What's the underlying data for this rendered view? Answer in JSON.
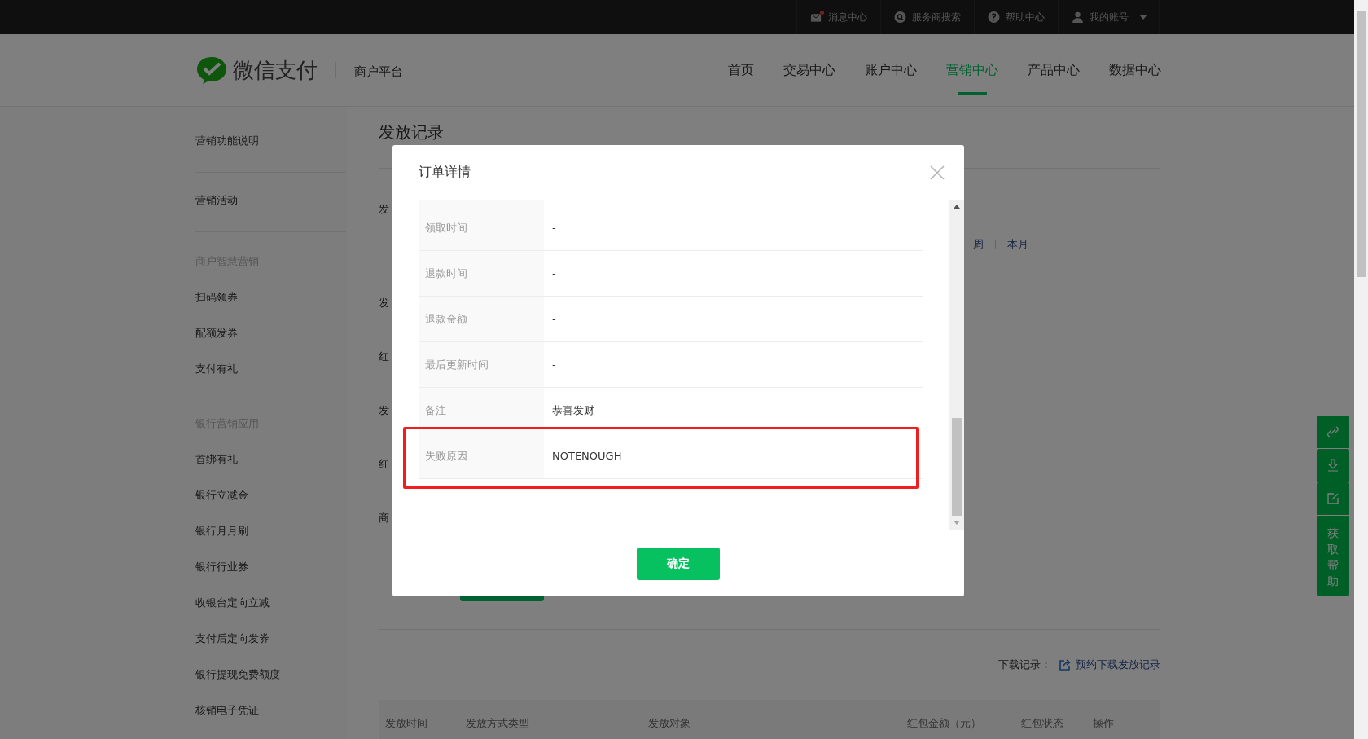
{
  "top_bar": {
    "items": [
      {
        "kind": "mail",
        "label": "消息中心",
        "unread": true
      },
      {
        "kind": "search",
        "label": "服务商搜索",
        "unread": false
      },
      {
        "kind": "help",
        "label": "帮助中心",
        "unread": false
      },
      {
        "kind": "account",
        "label": "我的账号",
        "unread": false
      }
    ]
  },
  "header": {
    "logo_text": "微信支付",
    "platform": "商户平台",
    "nav": [
      {
        "label": "首页",
        "selected": false
      },
      {
        "label": "交易中心",
        "selected": false
      },
      {
        "label": "账户中心",
        "selected": false
      },
      {
        "label": "营销中心",
        "selected": true
      },
      {
        "label": "产品中心",
        "selected": false
      },
      {
        "label": "数据中心",
        "selected": false
      }
    ]
  },
  "sidebar": {
    "sections": [
      {
        "items": [
          "营销功能说明"
        ]
      },
      {
        "items": [
          "营销活动"
        ]
      },
      {
        "heading": "商户智慧营销",
        "items": [
          "扫码领券",
          "配额发券",
          "支付有礼"
        ]
      },
      {
        "heading": "银行营销应用",
        "items": [
          "首绑有礼",
          "银行立减金",
          "银行月月刷",
          "银行行业券",
          "收银台定向立减",
          "支付后定向发券",
          "银行提现免费额度",
          "核销电子凭证"
        ]
      }
    ]
  },
  "main": {
    "title": "发放记录",
    "form_labels": [
      "发",
      "发",
      "红",
      "发",
      "红",
      "商"
    ],
    "date_links": [
      "周",
      "本月"
    ],
    "download_label": "下载记录：",
    "download_link": "预约下载发放记录",
    "table": {
      "columns": [
        "发放时间",
        "发放方式类型",
        "发放对象",
        "红包金额（元）",
        "红包状态",
        "操作"
      ]
    }
  },
  "modal": {
    "title": "订单详情",
    "rows": [
      {
        "label": "领取时间",
        "value": "-",
        "highlighted": false
      },
      {
        "label": "退款时间",
        "value": "-",
        "highlighted": false
      },
      {
        "label": "退款金额",
        "value": "-",
        "highlighted": false
      },
      {
        "label": "最后更新时间",
        "value": "-",
        "highlighted": false
      },
      {
        "label": "备注",
        "value": "恭喜发财",
        "highlighted": false
      },
      {
        "label": "失败原因",
        "value": "NOTENOUGH",
        "highlighted": true
      }
    ],
    "confirm": "确定"
  },
  "help_toolbar": {
    "label": "获取帮助"
  }
}
